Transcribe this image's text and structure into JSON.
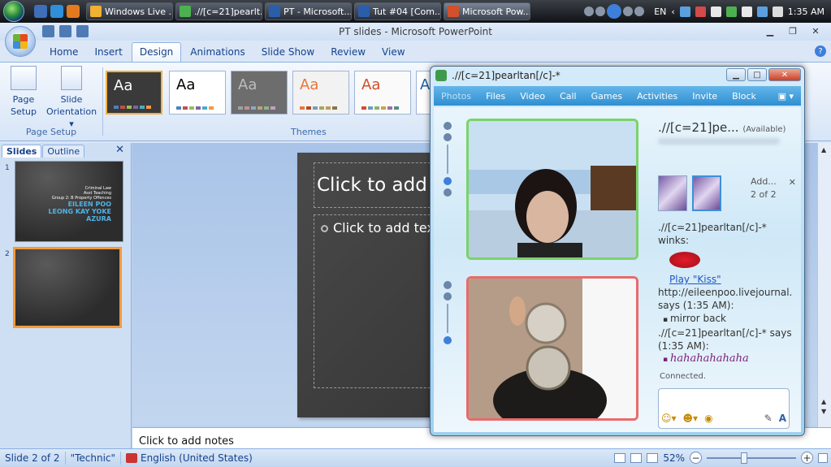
{
  "taskbar": {
    "tasks": [
      {
        "label": "Windows Live ...",
        "icon": "windows-live-icon"
      },
      {
        "label": ".//[c=21]pearlt...",
        "icon": "messenger-icon"
      },
      {
        "label": "PT - Microsoft...",
        "icon": "word-icon"
      },
      {
        "label": "Tut #04 [Com...",
        "icon": "word-icon"
      },
      {
        "label": "Microsoft Pow...",
        "icon": "powerpoint-icon"
      }
    ],
    "language": "EN",
    "clock": "1:35 AM"
  },
  "window": {
    "title": "PT slides - Microsoft PowerPoint"
  },
  "ribbon": {
    "tabs": [
      "Home",
      "Insert",
      "Design",
      "Animations",
      "Slide Show",
      "Review",
      "View"
    ],
    "active_tab": "Design",
    "page_setup_group": "Page Setup",
    "page_setup_btn": "Page Setup",
    "page_setup_line1": "Page",
    "page_setup_line2": "Setup",
    "orientation_line1": "Slide",
    "orientation_line2": "Orientation ▾",
    "themes_group": "Themes",
    "themes": [
      {
        "label": "Aa",
        "bg": "#3a3a3a",
        "fg": "#ffffff"
      },
      {
        "label": "Aa",
        "bg": "#ffffff",
        "fg": "#000000"
      },
      {
        "label": "Aa",
        "bg": "#6d6d6d",
        "fg": "#bdbdbd"
      },
      {
        "label": "Aa",
        "bg": "#f2f2f2",
        "fg": "#e8763a"
      },
      {
        "label": "Aa",
        "bg": "#fafafa",
        "fg": "#d04f2a"
      },
      {
        "label": "A",
        "bg": "#ffffff",
        "fg": "#1b5fa6"
      }
    ]
  },
  "left_pane": {
    "tabs": [
      "Slides",
      "Outline"
    ],
    "close": "✕",
    "slides": [
      {
        "number": "1",
        "small_lines": [
          "Criminal Law",
          "Asst Teaching",
          "Group 2: B Property Offences"
        ],
        "names": [
          "EILEEN POO",
          "LEONG KAY YOKE",
          "AZURA"
        ]
      },
      {
        "number": "2"
      }
    ]
  },
  "slide": {
    "title_placeholder": "Click to add title",
    "text_placeholder": "Click to add text"
  },
  "notes": {
    "placeholder": "Click to add notes"
  },
  "status_bar": {
    "slide_info": "Slide 2 of 2",
    "theme": "\"Technic\"",
    "language": "English (United States)",
    "zoom": "52%"
  },
  "messenger": {
    "title": ".//[c=21]pearltan[/c]-*",
    "menu": [
      "Photos",
      "Files",
      "Video",
      "Call",
      "Games",
      "Activities",
      "Invite",
      "Block"
    ],
    "contact_name": ".//[c=21]pe...",
    "contact_status": "(Available)",
    "add_label": "Add...",
    "pics_count": "2 of 2",
    "messages": {
      "line1": ".//[c=21]pearltan[/c]-* winks:",
      "play_link": "Play \"Kiss\"",
      "line2": "http://eileenpoo.livejournal.com says (1:35 AM):",
      "bullet1": "mirror back",
      "line3": ".//[c=21]pearltan[/c]-* says (1:35 AM):",
      "bullet2": "hahahahahaha"
    },
    "connection": "Connected."
  }
}
